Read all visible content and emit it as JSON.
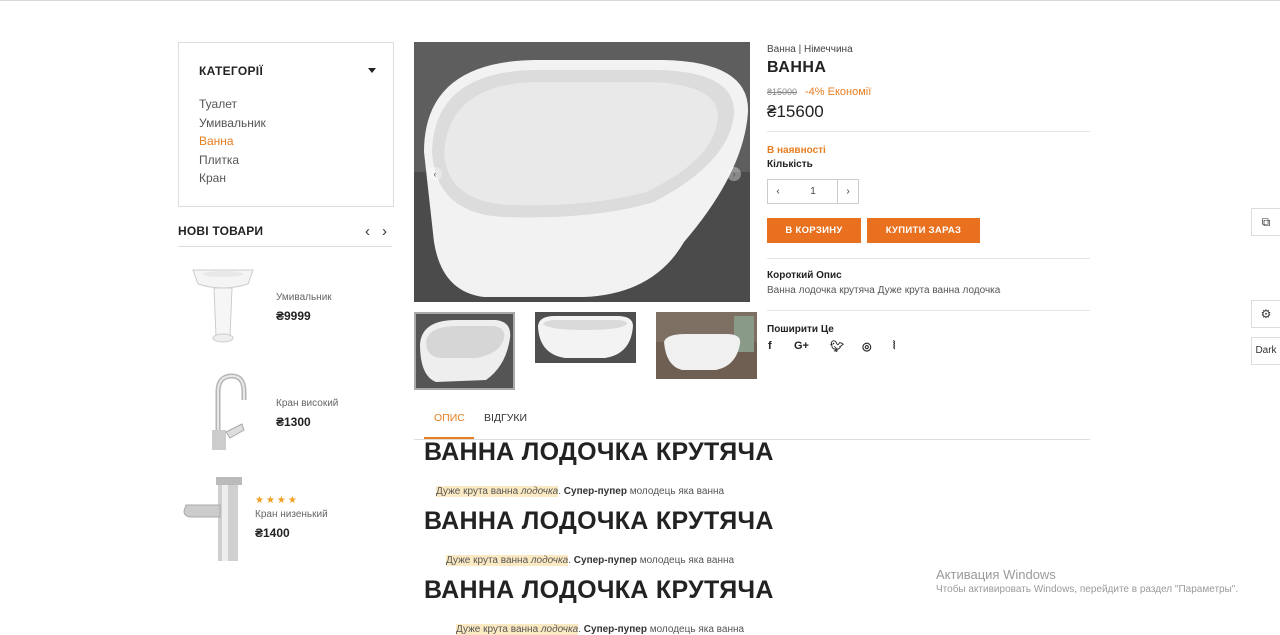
{
  "sidebar": {
    "categories_title": "КАТЕГОРІЇ",
    "categories": [
      {
        "label": "Туалет",
        "active": false
      },
      {
        "label": "Умивальник",
        "active": false
      },
      {
        "label": "Ванна",
        "active": true
      },
      {
        "label": "Плитка",
        "active": false
      },
      {
        "label": "Кран",
        "active": false
      }
    ],
    "new_products_title": "НОВІ ТОВАРИ",
    "new_products": [
      {
        "name": "Умивальник",
        "price": "₴9999"
      },
      {
        "name": "Кран високий",
        "price": "₴1300"
      },
      {
        "name": "Кран низенький",
        "price": "₴1400",
        "stars": "★★★★"
      }
    ]
  },
  "product": {
    "breadcrumb": "Ванна | Німеччина",
    "name": "ВАННА",
    "old_price": "₴15000",
    "discount": "-4% Економії",
    "price": "₴15600",
    "stock": "В наявності",
    "quantity_label": "Кількість",
    "quantity": "1",
    "add_to_cart": "В КОРЗИНУ",
    "buy_now": "КУПИТИ ЗАРАЗ",
    "short_desc_label": "Короткий Опис",
    "short_desc": "Ванна лодочка крутяча Дуже крута ванна лодочка",
    "share_label": "Поширити Це"
  },
  "tabs": [
    {
      "label": "ОПИС",
      "active": true
    },
    {
      "label": "ВІДГУКИ",
      "active": false
    }
  ],
  "description": {
    "heading": "ВАННА ЛОДОЧКА КРУТЯЧА",
    "hl_text": "Дуже крута ванна ",
    "hl_italic": "лодочка",
    "sep": ". ",
    "bold_text": "Супер-пупер",
    "rest_text": " молодець яка ванна"
  },
  "side_widgets": {
    "dark_label": "Dark"
  },
  "windows": {
    "title": "Активация Windows",
    "subtitle": "Чтобы активировать Windows, перейдите в раздел \"Параметры\"."
  },
  "colors": {
    "accent": "#e8701f"
  }
}
